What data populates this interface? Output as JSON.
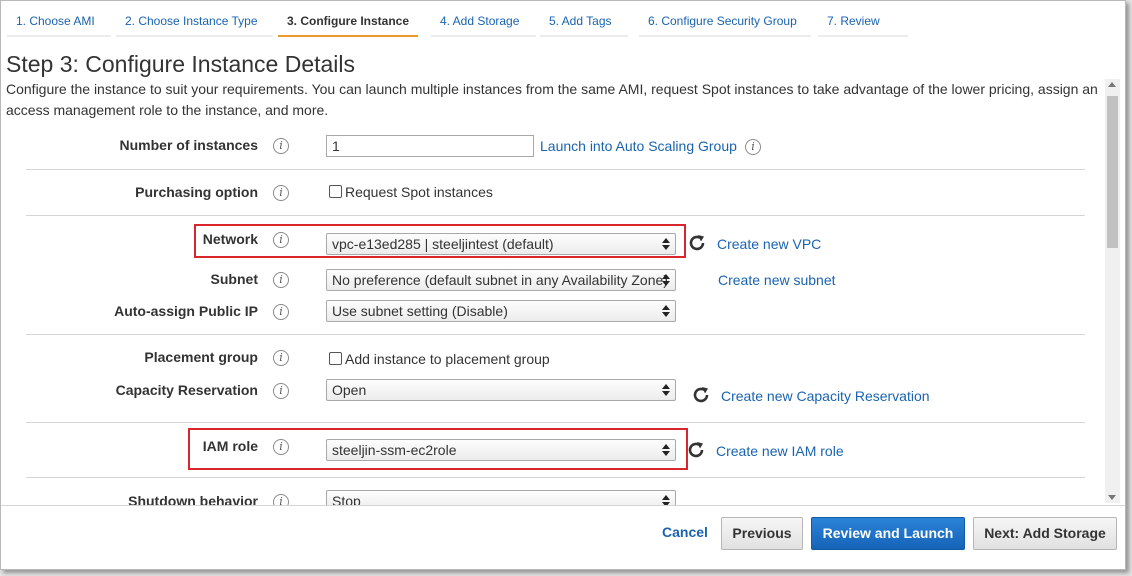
{
  "tabs": [
    {
      "label": "1. Choose AMI"
    },
    {
      "label": "2. Choose Instance Type"
    },
    {
      "label": "3. Configure Instance"
    },
    {
      "label": "4. Add Storage"
    },
    {
      "label": "5. Add Tags"
    },
    {
      "label": "6. Configure Security Group"
    },
    {
      "label": "7. Review"
    }
  ],
  "active_tab": "3. Configure Instance",
  "page": {
    "title": "Step 3: Configure Instance Details",
    "description": "Configure the instance to suit your requirements. You can launch multiple instances from the same AMI, request Spot instances to take advantage of the lower pricing, assign an access management role to the instance, and more."
  },
  "form": {
    "number_of_instances": {
      "label": "Number of instances",
      "value": "1",
      "link": "Launch into Auto Scaling Group"
    },
    "purchasing_option": {
      "label": "Purchasing option",
      "checkbox_label": "Request Spot instances",
      "checked": false
    },
    "network": {
      "label": "Network",
      "value": "vpc-e13ed285 | steeljintest (default)",
      "link": "Create new VPC"
    },
    "subnet": {
      "label": "Subnet",
      "value": "No preference (default subnet in any Availability Zone)",
      "link": "Create new subnet"
    },
    "auto_assign_ip": {
      "label": "Auto-assign Public IP",
      "value": "Use subnet setting (Disable)"
    },
    "placement_group": {
      "label": "Placement group",
      "checkbox_label": "Add instance to placement group",
      "checked": false
    },
    "capacity_reservation": {
      "label": "Capacity Reservation",
      "value": "Open",
      "link": "Create new Capacity Reservation"
    },
    "iam_role": {
      "label": "IAM role",
      "value": "steeljin-ssm-ec2role",
      "link": "Create new IAM role"
    },
    "shutdown_behavior": {
      "label": "Shutdown behavior",
      "value": "Stop"
    }
  },
  "footer": {
    "cancel": "Cancel",
    "previous": "Previous",
    "review_launch": "Review and Launch",
    "next": "Next: Add Storage"
  },
  "colors": {
    "link": "#1a63b0",
    "primary_button": "#1f73c8",
    "active_tab_underline": "#ec9a2a",
    "highlight_box": "#d9262c"
  },
  "info_icon_glyph": "i"
}
